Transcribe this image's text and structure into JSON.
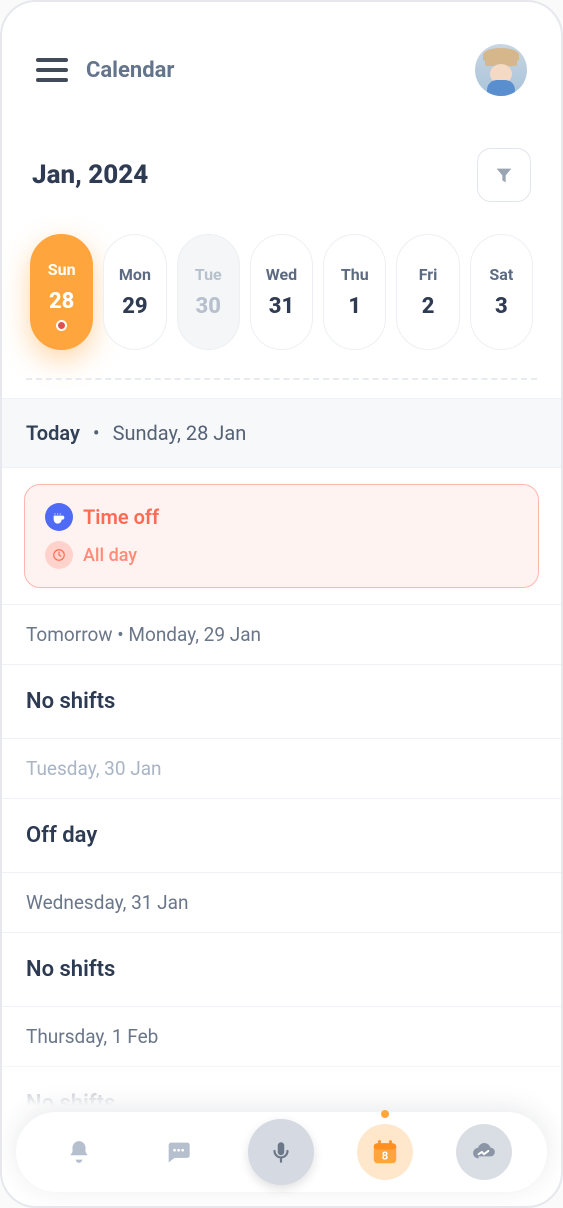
{
  "header": {
    "title": "Calendar"
  },
  "month": {
    "label": "Jan, 2024"
  },
  "days": [
    {
      "dow": "Sun",
      "num": "28",
      "state": "selected"
    },
    {
      "dow": "Mon",
      "num": "29",
      "state": "normal"
    },
    {
      "dow": "Tue",
      "num": "30",
      "state": "muted"
    },
    {
      "dow": "Wed",
      "num": "31",
      "state": "normal"
    },
    {
      "dow": "Thu",
      "num": "1",
      "state": "normal"
    },
    {
      "dow": "Fri",
      "num": "2",
      "state": "normal"
    },
    {
      "dow": "Sat",
      "num": "3",
      "state": "normal"
    }
  ],
  "sections": {
    "today": {
      "prefix": "Today",
      "date": "Sunday, 28 Jan"
    },
    "tomorrow": {
      "prefix": "Tomorrow",
      "date": "Monday, 29 Jan"
    }
  },
  "card": {
    "title": "Time off",
    "subtitle": "All day"
  },
  "rows": [
    {
      "header": "Tomorrow  •  Monday, 29 Jan",
      "body": "No shifts"
    },
    {
      "header": "Tuesday, 30 Jan",
      "body": "Off day",
      "muted": true
    },
    {
      "header": "Wednesday, 31 Jan",
      "body": "No shifts"
    },
    {
      "header": "Thursday, 1 Feb",
      "body": "No shifts"
    }
  ],
  "nav": {
    "items": [
      "notifications",
      "messages",
      "voice",
      "calendar",
      "analytics"
    ],
    "active": "calendar"
  },
  "colors": {
    "accent": "#ffa53e",
    "danger": "#fe6b52"
  }
}
